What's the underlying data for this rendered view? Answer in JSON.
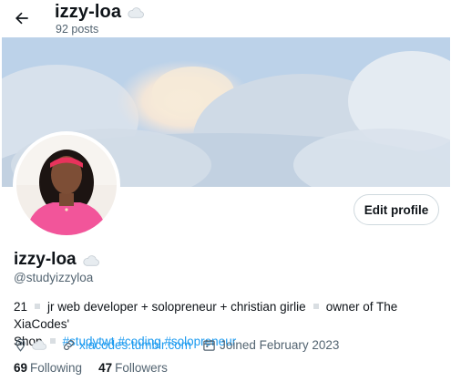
{
  "header": {
    "display_name": "izzy-loa",
    "posts_count": "92 posts"
  },
  "profile": {
    "display_name": "izzy-loa",
    "handle": "@studyizzyloa",
    "edit_label": "Edit profile",
    "bio": {
      "age": "21",
      "role": "jr web developer + solopreneur + christian girlie",
      "shop_line1": "owner of The XiaCodes'",
      "shop_line2": "Shop",
      "hashtags": [
        "#studytwt",
        "#coding",
        "#solopreneur"
      ]
    },
    "website": "xiacodes.tumblr.com",
    "joined": "Joined February 2023",
    "following_count": "69",
    "following_label": "Following",
    "followers_count": "47",
    "followers_label": "Followers"
  },
  "icons": {
    "back": "arrow-left-icon",
    "cloud": "cloud-emoji-icon",
    "location": "location-pin-icon",
    "link": "link-icon",
    "calendar": "calendar-icon"
  },
  "colors": {
    "accent": "#1d9bf0",
    "secondary_text": "#536471",
    "primary_text": "#0f1419",
    "border": "#cfd9de"
  }
}
